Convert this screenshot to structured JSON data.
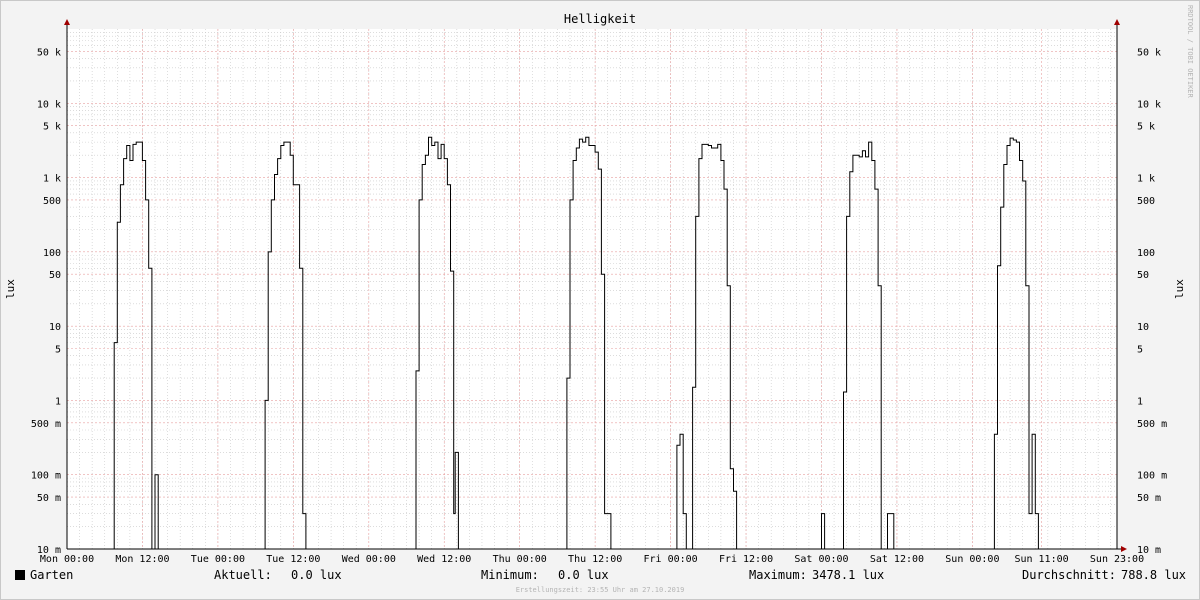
{
  "chart_data": {
    "type": "line",
    "title": "Helligkeit",
    "ylabel": "lux",
    "y_scale": "log",
    "ylim": [
      0.01,
      100000
    ],
    "y_ticks": [
      {
        "value": 0.01,
        "label": "10 m"
      },
      {
        "value": 0.05,
        "label": "50 m"
      },
      {
        "value": 0.1,
        "label": "100 m"
      },
      {
        "value": 0.5,
        "label": "500 m"
      },
      {
        "value": 1,
        "label": "1"
      },
      {
        "value": 5,
        "label": "5"
      },
      {
        "value": 10,
        "label": "10"
      },
      {
        "value": 50,
        "label": "50"
      },
      {
        "value": 100,
        "label": "100"
      },
      {
        "value": 500,
        "label": "500"
      },
      {
        "value": 1000,
        "label": "1 k"
      },
      {
        "value": 5000,
        "label": "5 k"
      },
      {
        "value": 10000,
        "label": "10 k"
      },
      {
        "value": 50000,
        "label": "50 k"
      }
    ],
    "x_ticks": [
      "Mon 00:00",
      "Mon 12:00",
      "Tue 00:00",
      "Tue 12:00",
      "Wed 00:00",
      "Wed 12:00",
      "Thu 00:00",
      "Thu 12:00",
      "Fri 00:00",
      "Fri 12:00",
      "Sat 00:00",
      "Sat 12:00",
      "Sun 00:00",
      "Sun 11:00",
      "Sun 23:00"
    ],
    "series": [
      {
        "name": "Garten",
        "color": "#000000",
        "points": [
          [
            "Mon 00:00",
            0.01
          ],
          [
            "Mon 07:30",
            0.01
          ],
          [
            "Mon 07:30",
            6
          ],
          [
            "Mon 08:00",
            6
          ],
          [
            "Mon 08:00",
            250
          ],
          [
            "Mon 08:30",
            250
          ],
          [
            "Mon 08:30",
            800
          ],
          [
            "Mon 09:00",
            800
          ],
          [
            "Mon 09:00",
            1800
          ],
          [
            "Mon 09:30",
            1800
          ],
          [
            "Mon 09:30",
            2700
          ],
          [
            "Mon 10:00",
            2700
          ],
          [
            "Mon 10:00",
            1700
          ],
          [
            "Mon 10:30",
            1700
          ],
          [
            "Mon 10:30",
            2800
          ],
          [
            "Mon 11:00",
            2800
          ],
          [
            "Mon 11:00",
            3000
          ],
          [
            "Mon 12:00",
            3000
          ],
          [
            "Mon 12:00",
            1700
          ],
          [
            "Mon 12:30",
            1700
          ],
          [
            "Mon 12:30",
            500
          ],
          [
            "Mon 13:00",
            500
          ],
          [
            "Mon 13:00",
            60
          ],
          [
            "Mon 13:30",
            60
          ],
          [
            "Mon 13:30",
            0.01
          ],
          [
            "Mon 14:00",
            0.01
          ],
          [
            "Mon 14:00",
            0.1
          ],
          [
            "Mon 14:30",
            0.1
          ],
          [
            "Mon 14:30",
            0.01
          ],
          [
            "Tue 07:30",
            0.01
          ],
          [
            "Tue 07:30",
            1
          ],
          [
            "Tue 08:00",
            1
          ],
          [
            "Tue 08:00",
            100
          ],
          [
            "Tue 08:30",
            100
          ],
          [
            "Tue 08:30",
            500
          ],
          [
            "Tue 09:00",
            500
          ],
          [
            "Tue 09:00",
            1100
          ],
          [
            "Tue 09:30",
            1100
          ],
          [
            "Tue 09:30",
            1800
          ],
          [
            "Tue 10:00",
            1800
          ],
          [
            "Tue 10:00",
            2700
          ],
          [
            "Tue 10:30",
            2700
          ],
          [
            "Tue 10:30",
            3000
          ],
          [
            "Tue 11:30",
            3000
          ],
          [
            "Tue 11:30",
            2000
          ],
          [
            "Tue 12:00",
            2000
          ],
          [
            "Tue 12:00",
            800
          ],
          [
            "Tue 13:00",
            800
          ],
          [
            "Tue 13:00",
            60
          ],
          [
            "Tue 13:30",
            60
          ],
          [
            "Tue 13:30",
            0.03
          ],
          [
            "Tue 14:00",
            0.03
          ],
          [
            "Tue 14:00",
            0.01
          ],
          [
            "Wed 07:30",
            0.01
          ],
          [
            "Wed 07:30",
            2.5
          ],
          [
            "Wed 08:00",
            2.5
          ],
          [
            "Wed 08:00",
            500
          ],
          [
            "Wed 08:30",
            500
          ],
          [
            "Wed 08:30",
            1500
          ],
          [
            "Wed 09:00",
            1500
          ],
          [
            "Wed 09:00",
            2000
          ],
          [
            "Wed 09:30",
            2000
          ],
          [
            "Wed 09:30",
            3500
          ],
          [
            "Wed 10:00",
            3500
          ],
          [
            "Wed 10:00",
            2700
          ],
          [
            "Wed 10:30",
            2700
          ],
          [
            "Wed 10:30",
            3000
          ],
          [
            "Wed 11:00",
            3000
          ],
          [
            "Wed 11:00",
            1800
          ],
          [
            "Wed 11:30",
            1800
          ],
          [
            "Wed 11:30",
            2800
          ],
          [
            "Wed 12:00",
            2800
          ],
          [
            "Wed 12:00",
            1800
          ],
          [
            "Wed 12:30",
            1800
          ],
          [
            "Wed 12:30",
            800
          ],
          [
            "Wed 13:00",
            800
          ],
          [
            "Wed 13:00",
            55
          ],
          [
            "Wed 13:30",
            55
          ],
          [
            "Wed 13:30",
            0.03
          ],
          [
            "Wed 13:45",
            0.03
          ],
          [
            "Wed 13:45",
            0.2
          ],
          [
            "Wed 14:15",
            0.2
          ],
          [
            "Wed 14:15",
            0.01
          ],
          [
            "Thu 07:30",
            0.01
          ],
          [
            "Thu 07:30",
            2
          ],
          [
            "Thu 08:00",
            2
          ],
          [
            "Thu 08:00",
            500
          ],
          [
            "Thu 08:30",
            500
          ],
          [
            "Thu 08:30",
            1700
          ],
          [
            "Thu 09:00",
            1700
          ],
          [
            "Thu 09:00",
            2500
          ],
          [
            "Thu 09:30",
            2500
          ],
          [
            "Thu 09:30",
            3300
          ],
          [
            "Thu 10:00",
            3300
          ],
          [
            "Thu 10:00",
            3000
          ],
          [
            "Thu 10:30",
            3000
          ],
          [
            "Thu 10:30",
            3500
          ],
          [
            "Thu 11:00",
            3500
          ],
          [
            "Thu 11:00",
            2700
          ],
          [
            "Thu 12:00",
            2700
          ],
          [
            "Thu 12:00",
            2200
          ],
          [
            "Thu 12:30",
            2200
          ],
          [
            "Thu 12:30",
            1300
          ],
          [
            "Thu 13:00",
            1300
          ],
          [
            "Thu 13:00",
            50
          ],
          [
            "Thu 13:30",
            50
          ],
          [
            "Thu 13:30",
            0.03
          ],
          [
            "Thu 14:30",
            0.03
          ],
          [
            "Thu 14:30",
            0.01
          ],
          [
            "Fri 01:00",
            0.01
          ],
          [
            "Fri 01:00",
            0.25
          ],
          [
            "Fri 01:30",
            0.25
          ],
          [
            "Fri 01:30",
            0.35
          ],
          [
            "Fri 02:00",
            0.35
          ],
          [
            "Fri 02:00",
            0.03
          ],
          [
            "Fri 02:30",
            0.03
          ],
          [
            "Fri 02:30",
            0.01
          ],
          [
            "Fri 03:30",
            0.01
          ],
          [
            "Fri 03:30",
            1.5
          ],
          [
            "Fri 04:00",
            1.5
          ],
          [
            "Fri 04:00",
            300
          ],
          [
            "Fri 04:30",
            300
          ],
          [
            "Fri 04:30",
            1800
          ],
          [
            "Fri 05:00",
            1800
          ],
          [
            "Fri 05:00",
            2800
          ],
          [
            "Fri 06:00",
            2800
          ],
          [
            "Fri 06:00",
            2700
          ],
          [
            "Fri 06:30",
            2700
          ],
          [
            "Fri 06:30",
            2500
          ],
          [
            "Fri 07:30",
            2500
          ],
          [
            "Fri 07:30",
            2800
          ],
          [
            "Fri 08:00",
            2800
          ],
          [
            "Fri 08:00",
            1700
          ],
          [
            "Fri 08:30",
            1700
          ],
          [
            "Fri 08:30",
            700
          ],
          [
            "Fri 09:00",
            700
          ],
          [
            "Fri 09:00",
            35
          ],
          [
            "Fri 09:30",
            35
          ],
          [
            "Fri 09:30",
            0.12
          ],
          [
            "Fri 10:00",
            0.12
          ],
          [
            "Fri 10:00",
            0.06
          ],
          [
            "Fri 10:30",
            0.06
          ],
          [
            "Fri 10:30",
            0.01
          ],
          [
            "Sat 00:00",
            0.01
          ],
          [
            "Sat 00:00",
            0.03
          ],
          [
            "Sat 00:30",
            0.03
          ],
          [
            "Sat 00:30",
            0.01
          ],
          [
            "Sat 03:30",
            0.01
          ],
          [
            "Sat 03:30",
            1.3
          ],
          [
            "Sat 04:00",
            1.3
          ],
          [
            "Sat 04:00",
            300
          ],
          [
            "Sat 04:30",
            300
          ],
          [
            "Sat 04:30",
            1200
          ],
          [
            "Sat 05:00",
            1200
          ],
          [
            "Sat 05:00",
            2000
          ],
          [
            "Sat 06:00",
            2000
          ],
          [
            "Sat 06:00",
            1900
          ],
          [
            "Sat 06:30",
            1900
          ],
          [
            "Sat 06:30",
            2300
          ],
          [
            "Sat 07:00",
            2300
          ],
          [
            "Sat 07:00",
            1900
          ],
          [
            "Sat 07:30",
            1900
          ],
          [
            "Sat 07:30",
            3000
          ],
          [
            "Sat 08:00",
            3000
          ],
          [
            "Sat 08:00",
            1700
          ],
          [
            "Sat 08:30",
            1700
          ],
          [
            "Sat 08:30",
            700
          ],
          [
            "Sat 09:00",
            700
          ],
          [
            "Sat 09:00",
            35
          ],
          [
            "Sat 09:30",
            35
          ],
          [
            "Sat 09:30",
            0.01
          ],
          [
            "Sat 10:30",
            0.01
          ],
          [
            "Sat 10:30",
            0.03
          ],
          [
            "Sat 11:30",
            0.03
          ],
          [
            "Sat 11:30",
            0.01
          ],
          [
            "Sun 03:30",
            0.01
          ],
          [
            "Sun 03:30",
            0.35
          ],
          [
            "Sun 04:00",
            0.35
          ],
          [
            "Sun 04:00",
            65
          ],
          [
            "Sun 04:30",
            65
          ],
          [
            "Sun 04:30",
            400
          ],
          [
            "Sun 05:00",
            400
          ],
          [
            "Sun 05:00",
            1500
          ],
          [
            "Sun 05:30",
            1500
          ],
          [
            "Sun 05:30",
            2700
          ],
          [
            "Sun 06:00",
            2700
          ],
          [
            "Sun 06:00",
            3400
          ],
          [
            "Sun 06:30",
            3400
          ],
          [
            "Sun 06:30",
            3200
          ],
          [
            "Sun 07:00",
            3200
          ],
          [
            "Sun 07:00",
            3000
          ],
          [
            "Sun 07:30",
            3000
          ],
          [
            "Sun 07:30",
            1700
          ],
          [
            "Sun 08:00",
            1700
          ],
          [
            "Sun 08:00",
            900
          ],
          [
            "Sun 08:30",
            900
          ],
          [
            "Sun 08:30",
            35
          ],
          [
            "Sun 09:00",
            35
          ],
          [
            "Sun 09:00",
            0.03
          ],
          [
            "Sun 09:30",
            0.03
          ],
          [
            "Sun 09:30",
            0.35
          ],
          [
            "Sun 10:00",
            0.35
          ],
          [
            "Sun 10:00",
            0.03
          ],
          [
            "Sun 10:30",
            0.03
          ],
          [
            "Sun 10:30",
            0.01
          ],
          [
            "Sun 23:00",
            0.01
          ]
        ]
      }
    ]
  },
  "legend": {
    "series_name": "Garten",
    "current_label": "Aktuell:",
    "current_value": "0.0 lux",
    "minimum_label": "Minimum:",
    "minimum_value": "0.0 lux",
    "maximum_label": "Maximum:",
    "maximum_value": "3478.1 lux",
    "average_label": "Durchschnitt:",
    "average_value": "788.8 lux"
  },
  "watermark": "RRDTOOL / TOBI OETIKER",
  "footer": "Erstellungszeit: 23:55 Uhr am 27.10.2019",
  "colors": {
    "background": "#f3f3f3",
    "plot_background": "#ffffff",
    "major_grid": "#e8a0a0",
    "minor_grid": "#c8c8c8",
    "line": "#000000",
    "arrow": "#a00000"
  }
}
